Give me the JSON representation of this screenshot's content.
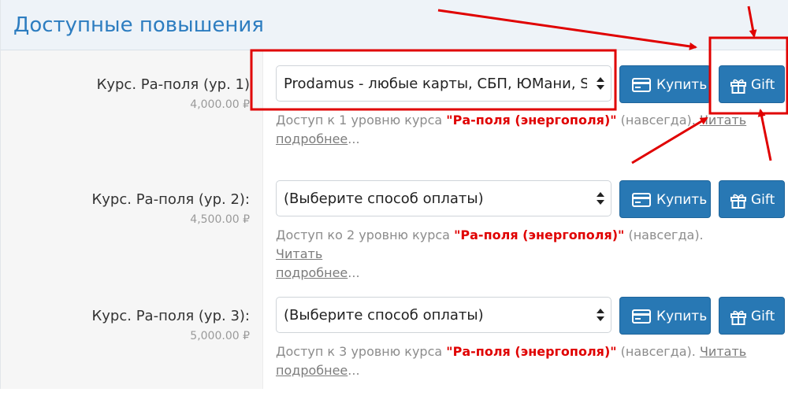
{
  "panel": {
    "title": "Доступные повышения"
  },
  "rows": [
    {
      "name": "Курс. Ра-поля (ур. 1)",
      "price": "4,000.00 ₽",
      "payment_value": "Prodamus - любые карты, СБП, ЮМани, Sk",
      "buy_label": "Купить",
      "gift_label": "Gift",
      "desc_prefix": "Доступ к 1 уровню курса ",
      "desc_course": "\"Ра-поля (энергополя)\"",
      "desc_suffix": " (навсегда). ",
      "desc_link_1": "Читать",
      "desc_link_2": "подробнее",
      "desc_ellipsis": "..."
    },
    {
      "name": "Курс. Ра-поля (ур. 2):",
      "price": "4,500.00 ₽",
      "payment_value": "(Выберите способ оплаты)",
      "buy_label": "Купить",
      "gift_label": "Gift",
      "desc_prefix": "Доступ ко 2 уровню курса ",
      "desc_course": "\"Ра-поля (энергополя)\"",
      "desc_suffix": " (навсегда). ",
      "desc_link_1": "Читать",
      "desc_link_2": "подробнее",
      "desc_ellipsis": "..."
    },
    {
      "name": "Курс. Ра-поля (ур. 3):",
      "price": "5,000.00 ₽",
      "payment_value": "(Выберите способ оплаты)",
      "buy_label": "Купить",
      "gift_label": "Gift",
      "desc_prefix": "Доступ к 3 уровню курса ",
      "desc_course": "\"Ра-поля (энергополя)\"",
      "desc_suffix": " (навсегда). ",
      "desc_link_1": "Читать",
      "desc_link_2": "подробнее",
      "desc_ellipsis": "..."
    }
  ],
  "icons": {
    "buy": "credit-card-icon",
    "gift": "gift-icon",
    "select": "select-caret-icon"
  },
  "colors": {
    "accent": "#2878b4",
    "title": "#2d7dc0",
    "course_highlight": "#e00000",
    "annotation": "#e00000"
  }
}
